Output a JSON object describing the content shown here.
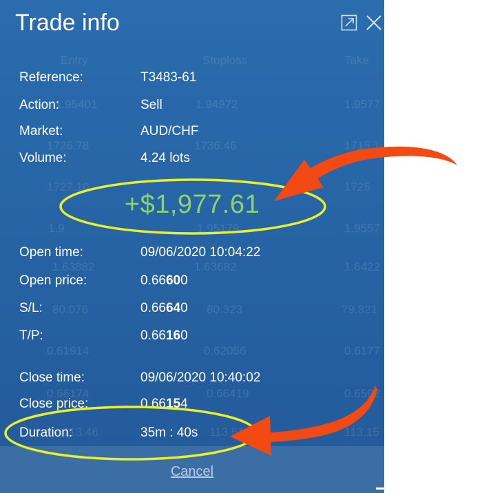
{
  "window": {
    "title": "Trade info",
    "popout_icon": "popout-icon",
    "close_icon": "close-icon"
  },
  "details": {
    "reference": {
      "label": "Reference:",
      "value": "T3483-61"
    },
    "action": {
      "label": "Action:",
      "value": "Sell"
    },
    "market": {
      "label": "Market:",
      "value": "AUD/CHF"
    },
    "volume": {
      "label": "Volume:",
      "value": "4.24 lots"
    }
  },
  "pnl": "+$1,977.61",
  "open": {
    "time": {
      "label": "Open time:",
      "value": "09/06/2020 10:04:22"
    },
    "price": {
      "label": "Open price:",
      "pre": "0.66",
      "bold": "60",
      "post": "0"
    },
    "sl": {
      "label": "S/L:",
      "pre": "0.66",
      "bold": "64",
      "post": "0"
    },
    "tp": {
      "label": "T/P:",
      "pre": "0.66",
      "bold": "16",
      "post": "0"
    }
  },
  "close": {
    "time": {
      "label": "Close time:",
      "value": "09/06/2020 10:40:02"
    },
    "price": {
      "label": "Close price:",
      "pre": "0.66",
      "bold": "15",
      "post": "4"
    },
    "duration": {
      "label": "Duration:",
      "value": "35m : 40s"
    }
  },
  "footer": {
    "cancel_label": "Cancel"
  },
  "background_table": {
    "headers": [
      "Entry",
      "Stoploss",
      "Take"
    ],
    "rows": [
      [
        "1.95401",
        "1.94972",
        "1.9577"
      ],
      [
        "1726.78",
        "1736.46",
        "1715.1"
      ],
      [
        "1727.10",
        "",
        "1725"
      ],
      [
        "1.9",
        "1.95179",
        "1.9557"
      ],
      [
        "1.63882",
        "1.63682",
        "1.6422"
      ],
      [
        "80.076",
        "80.323",
        "79.821"
      ],
      [
        "0.61914",
        "0.62056",
        "0.6177"
      ],
      [
        "0.66174",
        "0.66419",
        "0.6592"
      ],
      [
        "113.46",
        "113.51",
        "113.15"
      ]
    ]
  },
  "colors": {
    "panel": "#2765a6",
    "pnl_green": "#8ad46b",
    "highlight_ellipse": "#e8f02a",
    "arrow": "#f24a12"
  }
}
